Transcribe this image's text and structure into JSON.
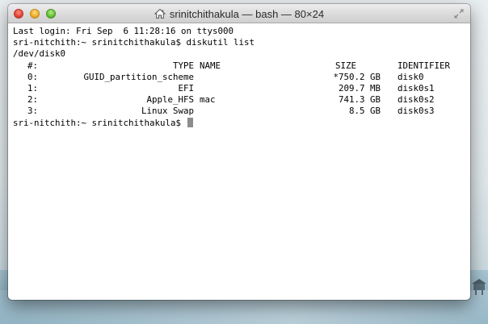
{
  "window": {
    "title": "srinitchithakula — bash — 80×24"
  },
  "terminal": {
    "last_login": "Last login: Fri Sep  6 11:28:16 on ttys000",
    "prompt_command": "sri-nitchith:~ srinitchithakula$ diskutil list",
    "disk": "/dev/disk0",
    "table_header": {
      "index": "#:",
      "type": "TYPE",
      "name": "NAME",
      "size": "SIZE",
      "identifier": "IDENTIFIER"
    },
    "rows": [
      {
        "index": "0:",
        "type": "GUID_partition_scheme",
        "name": "",
        "size": "*750.2 GB",
        "identifier": "disk0"
      },
      {
        "index": "1:",
        "type": "EFI",
        "name": "",
        "size": "209.7 MB",
        "identifier": "disk0s1"
      },
      {
        "index": "2:",
        "type": "Apple_HFS",
        "name": "mac",
        "size": "741.3 GB",
        "identifier": "disk0s2"
      },
      {
        "index": "3:",
        "type": "Linux Swap",
        "name": "",
        "size": "8.5 GB",
        "identifier": "disk0s3"
      }
    ],
    "prompt": "sri-nitchith:~ srinitchithakula$ "
  },
  "icons": {
    "title_icon": "home-icon",
    "fullscreen_icon": "fullscreen-arrows-icon"
  }
}
